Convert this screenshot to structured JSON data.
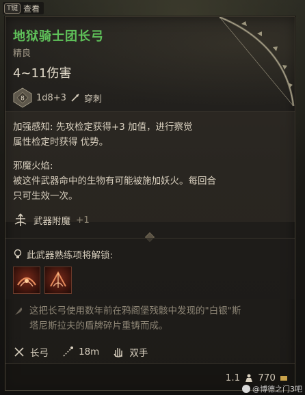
{
  "hint": {
    "key": "T键",
    "label": "查看"
  },
  "item": {
    "name": "地狱骑士团长弓",
    "rarity": "精良",
    "damage": "4~11伤害",
    "dice_badge": "8",
    "dice_formula": "1d8+3",
    "damage_type": "穿刺",
    "ability1_line1": "加强感知: 先攻检定获得+3 加值，进行察觉",
    "ability1_line2": "属性检定时获得 优势。",
    "ability2_title": "邪魔火焰:",
    "ability2_line1": "被这件武器命中的生物有可能被施加妖火。每回合",
    "ability2_line2": "只可生效一次。",
    "enchant_label": "武器附魔",
    "enchant_value": "+1",
    "unlock_label": "此武器熟练项将解锁:",
    "lore_line1": "这把长弓使用数年前在鸦阁堡残骸中发现的\"白银\"斯",
    "lore_line2": "塔尼斯拉夫的盾牌碎片重铸而成。",
    "weapon_type": "长弓",
    "range": "18m",
    "hands": "双手",
    "weight": "1.1",
    "value": "770"
  },
  "watermark": "@博德之门3吧",
  "colors": {
    "title": "#5fc25a",
    "text": "#d9d0bf",
    "muted": "#8e8676",
    "panel": "#221f1b"
  }
}
